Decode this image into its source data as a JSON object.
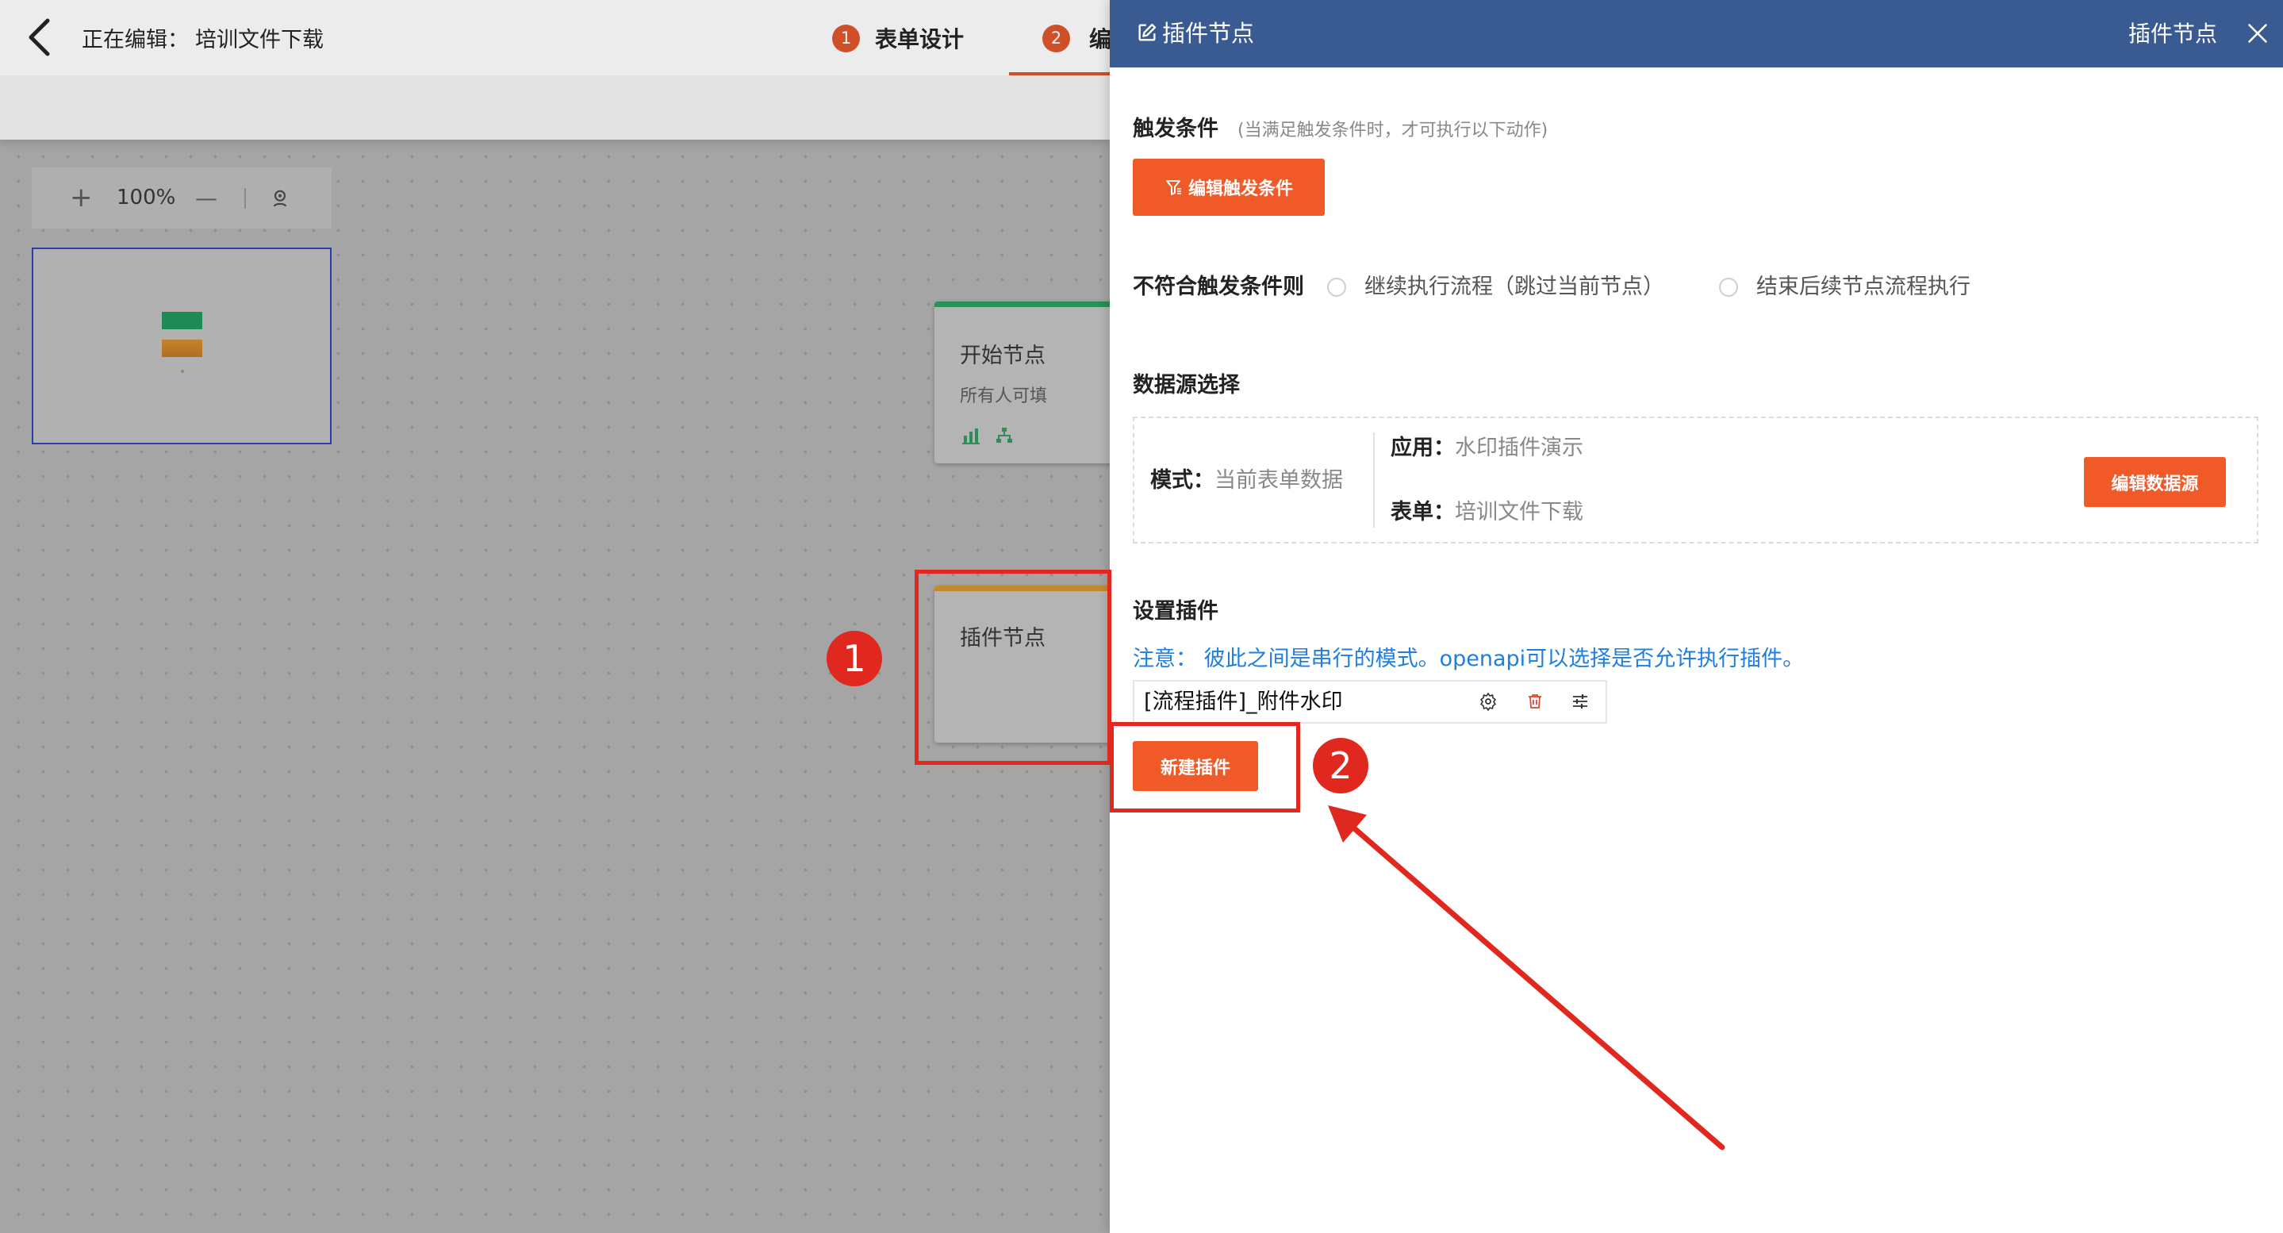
{
  "theme": {
    "accent": "#f05a28",
    "header_blue": "#3a5a92",
    "note_blue": "#1e7fe0",
    "start_green": "#2b8f58",
    "plugin_orange": "#c4892f",
    "annotation_red": "#e0281e"
  },
  "editor": {
    "back_icon": "chevron-left-icon",
    "editing_label": "正在编辑：",
    "form_name": "培训文件下载",
    "steps": [
      {
        "number": "1",
        "label": "表单设计"
      },
      {
        "number": "2",
        "label": "编"
      }
    ]
  },
  "canvas": {
    "zoom_in": "+",
    "zoom_level": "100%",
    "zoom_out": "—",
    "locate_icon": "locate-user-icon",
    "nodes": {
      "start": {
        "title": "开始节点",
        "subtitle": "所有人可填",
        "icons": [
          "bar-chart-icon",
          "sitemap-icon"
        ]
      },
      "plugin": {
        "title": "插件节点"
      }
    }
  },
  "panel": {
    "title": "插件节点",
    "header_right": "插件节点",
    "trigger": {
      "label": "触发条件",
      "hint": "(当满足触发条件时，才可执行以下动作)",
      "edit_button": "编辑触发条件"
    },
    "mismatch": {
      "label": "不符合触发条件则",
      "options": [
        "继续执行流程（跳过当前节点）",
        "结束后续节点流程执行"
      ]
    },
    "datasource": {
      "label": "数据源选择",
      "mode_label": "模式：",
      "mode_value": "当前表单数据",
      "app_label": "应用：",
      "app_value": "水印插件演示",
      "form_label": "表单：",
      "form_value": "培训文件下载",
      "edit_button": "编辑数据源"
    },
    "plugins": {
      "label": "设置插件",
      "note": "注意： 彼此之间是串行的模式。openapi可以选择是否允许执行插件。",
      "items": [
        {
          "name": "[流程插件]_附件水印",
          "actions": [
            "gear-icon",
            "trash-icon",
            "sliders-icon"
          ]
        }
      ],
      "new_button": "新建插件"
    }
  },
  "annotations": {
    "marker_1": "1",
    "marker_2": "2"
  }
}
